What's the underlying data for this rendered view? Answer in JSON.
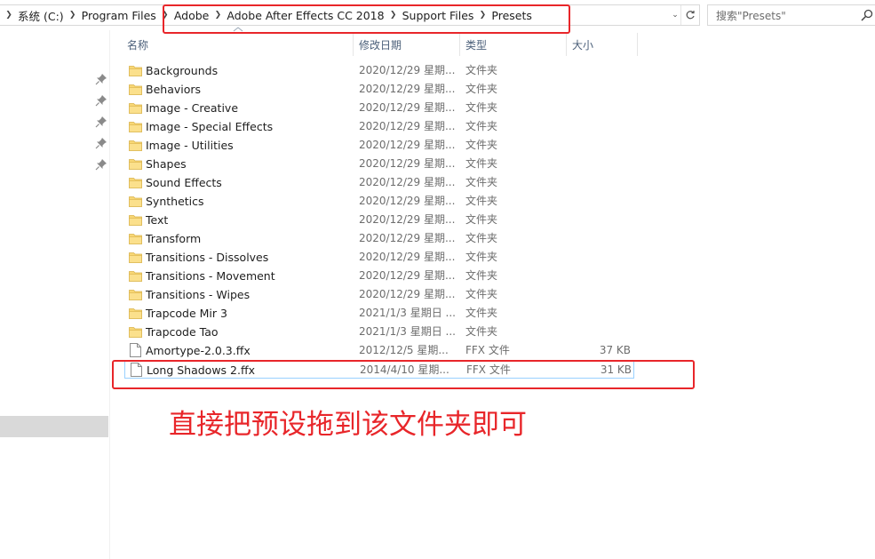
{
  "address_bar": {
    "crumbs": [
      "系统 (C:)",
      "Program Files",
      "Adobe",
      "Adobe After Effects CC 2018",
      "Support Files",
      "Presets"
    ]
  },
  "search": {
    "placeholder": "搜索\"Presets\""
  },
  "columns": {
    "name": "名称",
    "date": "修改日期",
    "type": "类型",
    "size": "大小"
  },
  "files": [
    {
      "name": "Backgrounds",
      "date": "2020/12/29 星期...",
      "type": "文件夹",
      "size": "",
      "kind": "folder"
    },
    {
      "name": "Behaviors",
      "date": "2020/12/29 星期...",
      "type": "文件夹",
      "size": "",
      "kind": "folder"
    },
    {
      "name": "Image - Creative",
      "date": "2020/12/29 星期...",
      "type": "文件夹",
      "size": "",
      "kind": "folder"
    },
    {
      "name": "Image - Special Effects",
      "date": "2020/12/29 星期...",
      "type": "文件夹",
      "size": "",
      "kind": "folder"
    },
    {
      "name": "Image - Utilities",
      "date": "2020/12/29 星期...",
      "type": "文件夹",
      "size": "",
      "kind": "folder"
    },
    {
      "name": "Shapes",
      "date": "2020/12/29 星期...",
      "type": "文件夹",
      "size": "",
      "kind": "folder"
    },
    {
      "name": "Sound Effects",
      "date": "2020/12/29 星期...",
      "type": "文件夹",
      "size": "",
      "kind": "folder"
    },
    {
      "name": "Synthetics",
      "date": "2020/12/29 星期...",
      "type": "文件夹",
      "size": "",
      "kind": "folder"
    },
    {
      "name": "Text",
      "date": "2020/12/29 星期...",
      "type": "文件夹",
      "size": "",
      "kind": "folder"
    },
    {
      "name": "Transform",
      "date": "2020/12/29 星期...",
      "type": "文件夹",
      "size": "",
      "kind": "folder"
    },
    {
      "name": "Transitions - Dissolves",
      "date": "2020/12/29 星期...",
      "type": "文件夹",
      "size": "",
      "kind": "folder"
    },
    {
      "name": "Transitions - Movement",
      "date": "2020/12/29 星期...",
      "type": "文件夹",
      "size": "",
      "kind": "folder"
    },
    {
      "name": "Transitions - Wipes",
      "date": "2020/12/29 星期...",
      "type": "文件夹",
      "size": "",
      "kind": "folder"
    },
    {
      "name": "Trapcode Mir 3",
      "date": "2021/1/3 星期日 ...",
      "type": "文件夹",
      "size": "",
      "kind": "folder"
    },
    {
      "name": "Trapcode Tao",
      "date": "2021/1/3 星期日 ...",
      "type": "文件夹",
      "size": "",
      "kind": "folder"
    },
    {
      "name": "Amortype-2.0.3.ffx",
      "date": "2012/12/5 星期...",
      "type": "FFX 文件",
      "size": "37 KB",
      "kind": "file"
    },
    {
      "name": "Long Shadows 2.ffx",
      "date": "2014/4/10 星期...",
      "type": "FFX 文件",
      "size": "31 KB",
      "kind": "file",
      "selected": true
    }
  ],
  "annotation": {
    "text": "直接把预设拖到该文件夹即可",
    "color": "#e8262a"
  },
  "icons": {
    "folder": "folder-icon",
    "file": "file-icon",
    "pin": "pin-icon",
    "search": "search-icon",
    "refresh": "refresh-icon",
    "chevron": "chevron-right-icon"
  },
  "colors": {
    "folder": "#f8d775",
    "header_text": "#4c607a",
    "selection_border": "#99d1ff",
    "annotation": "#e8262a"
  }
}
